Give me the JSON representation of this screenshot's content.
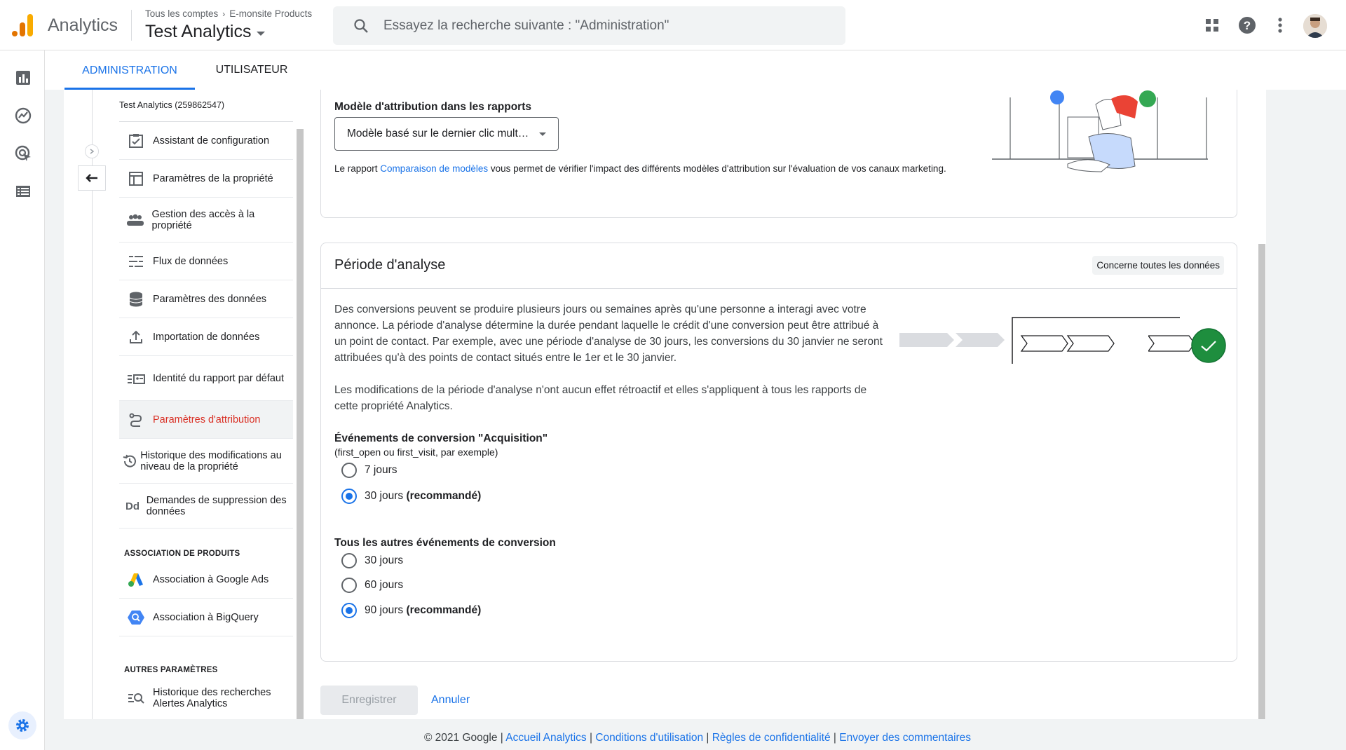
{
  "header": {
    "app_name": "Analytics",
    "breadcrumb": [
      "Tous les comptes",
      "E-monsite Products"
    ],
    "property": "Test Analytics",
    "search_placeholder": "Essayez la recherche suivante : \"Administration\""
  },
  "tabs": [
    {
      "label": "ADMINISTRATION",
      "active": true
    },
    {
      "label": "UTILISATEUR",
      "active": false
    }
  ],
  "sidebar": {
    "account_id": "Test Analytics (259862547)",
    "items": [
      {
        "label": "Assistant de configuration",
        "icon": "checklist-icon"
      },
      {
        "label": "Paramètres de la propriété",
        "icon": "layout-icon"
      },
      {
        "label": "Gestion des accès à la propriété",
        "icon": "people-icon"
      },
      {
        "label": "Flux de données",
        "icon": "streams-icon"
      },
      {
        "label": "Paramètres des données",
        "icon": "database-icon"
      },
      {
        "label": "Importation de données",
        "icon": "upload-icon"
      },
      {
        "label": "Identité du rapport par défaut",
        "icon": "identity-icon"
      },
      {
        "label": "Paramètres d'attribution",
        "icon": "attribution-icon",
        "active": true
      },
      {
        "label": "Historique des modifications au niveau de la propriété",
        "icon": "history-icon"
      },
      {
        "label": "Demandes de suppression des données",
        "icon": "dd-icon"
      }
    ],
    "section_products": "ASSOCIATION DE PRODUITS",
    "product_items": [
      {
        "label": "Association à Google Ads",
        "icon": "google-ads-icon"
      },
      {
        "label": "Association à BigQuery",
        "icon": "bigquery-icon"
      }
    ],
    "section_other": "AUTRES PARAMÈTRES",
    "other_items": [
      {
        "label": "Historique des recherches",
        "label2": "Alertes Analytics",
        "icon": "search-history-icon"
      }
    ]
  },
  "attribution": {
    "model_label": "Modèle d'attribution dans les rapports",
    "model_value": "Modèle basé sur le dernier clic mult…",
    "info_prefix": "Le rapport ",
    "info_link": "Comparaison de modèles",
    "info_suffix": " vous permet de vérifier l'impact des différents modèles d'attribution sur l'évaluation de vos canaux marketing."
  },
  "lookback": {
    "title": "Période d'analyse",
    "chip": "Concerne toutes les données",
    "para1": "Des conversions peuvent se produire plusieurs jours ou semaines après qu'une personne a interagi avec votre annonce. La période d'analyse détermine la durée pendant laquelle le crédit d'une conversion peut être attribué à un point de contact. Par exemple, avec une période d'analyse de 30 jours, les conversions du 30 janvier ne seront attribuées qu'à des points de contact situés entre le 1er et le 30 janvier.",
    "para2": "Les modifications de la période d'analyse n'ont aucun effet rétroactif et elles s'appliquent à tous les rapports de cette propriété Analytics.",
    "acq_title": "Événements de conversion \"Acquisition\"",
    "acq_sub": "(first_open ou first_visit, par exemple)",
    "acq_options": [
      {
        "text": "7 jours",
        "bold": "",
        "selected": false
      },
      {
        "text": "30 jours ",
        "bold": "(recommandé)",
        "selected": true
      }
    ],
    "other_title": "Tous les autres événements de conversion",
    "other_options": [
      {
        "text": "30 jours",
        "bold": "",
        "selected": false
      },
      {
        "text": "60 jours",
        "bold": "",
        "selected": false
      },
      {
        "text": "90 jours ",
        "bold": "(recommandé)",
        "selected": true
      }
    ]
  },
  "actions": {
    "save": "Enregistrer",
    "cancel": "Annuler"
  },
  "footer": {
    "copyright": "© 2021 Google",
    "links": [
      "Accueil Analytics",
      "Conditions d'utilisation",
      "Règles de confidentialité",
      "Envoyer des commentaires"
    ]
  },
  "colors": {
    "accent": "#1a73e8",
    "active_nav": "#d93025",
    "success": "#1e8e3e"
  }
}
